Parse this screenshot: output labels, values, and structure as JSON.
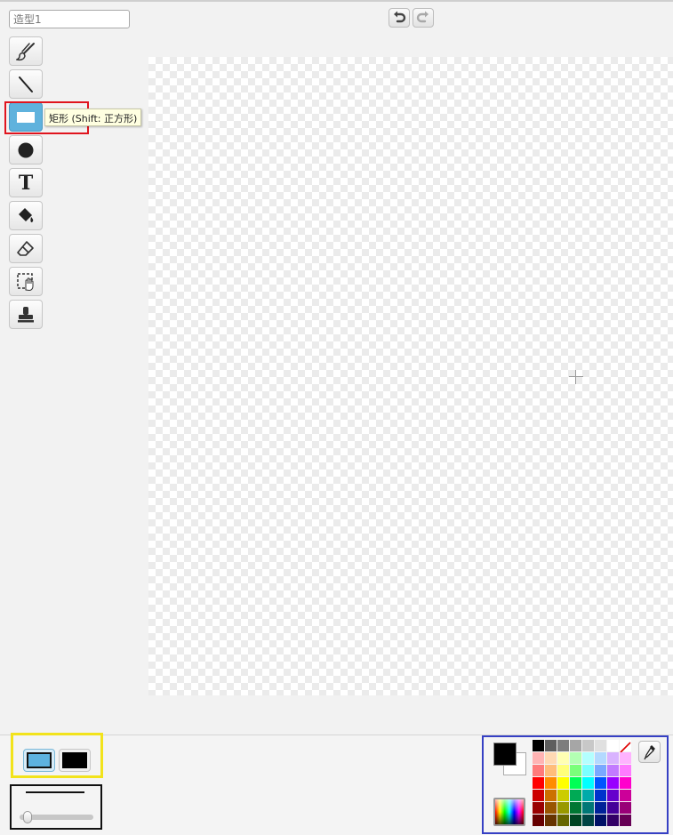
{
  "costume": {
    "name_value": "造型1"
  },
  "history": {
    "undo": "undo",
    "redo": "redo"
  },
  "tools": [
    {
      "key": "brush",
      "icon": "brush-icon"
    },
    {
      "key": "line",
      "icon": "line-icon"
    },
    {
      "key": "rectangle",
      "icon": "rectangle-icon",
      "selected": true
    },
    {
      "key": "ellipse",
      "icon": "ellipse-icon"
    },
    {
      "key": "text",
      "icon": "text-icon",
      "glyph": "T"
    },
    {
      "key": "fill",
      "icon": "paint-bucket-icon"
    },
    {
      "key": "eraser",
      "icon": "eraser-icon"
    },
    {
      "key": "select",
      "icon": "select-icon"
    },
    {
      "key": "stamp",
      "icon": "stamp-icon"
    }
  ],
  "tooltip": {
    "text": "矩形 (Shift: 正方形)"
  },
  "shape_options": {
    "fill_color": "#5db2e0",
    "outline_color": "#000000"
  },
  "stroke": {
    "width_fraction": 0.05
  },
  "colors": {
    "primary": "#000000",
    "secondary": "#ffffff",
    "palette": [
      "#000000",
      "#5e5e5e",
      "#7d7d7d",
      "#a6a6a6",
      "#c8c8c8",
      "#e0e0e0",
      "#ffffff",
      "none",
      "#ffb3b3",
      "#ffd9b3",
      "#ffffb3",
      "#b3ffb3",
      "#b3ffff",
      "#b3d9ff",
      "#d9b3ff",
      "#ffb3ff",
      "#ff7a7a",
      "#ffbd7a",
      "#ffff7a",
      "#7aff7a",
      "#7affff",
      "#7aa8ff",
      "#c27aff",
      "#ff7aff",
      "#ff0000",
      "#ff8c00",
      "#ffff00",
      "#00ff55",
      "#00ffff",
      "#0055ff",
      "#9900ff",
      "#ff00cc",
      "#cc0000",
      "#cc7000",
      "#cccc00",
      "#00aa55",
      "#00aaaa",
      "#0033cc",
      "#6600cc",
      "#cc0099",
      "#990000",
      "#995500",
      "#999900",
      "#007733",
      "#007777",
      "#002299",
      "#440099",
      "#990077",
      "#660000",
      "#663300",
      "#666600",
      "#004422",
      "#004444",
      "#001166",
      "#330066",
      "#660055"
    ]
  }
}
